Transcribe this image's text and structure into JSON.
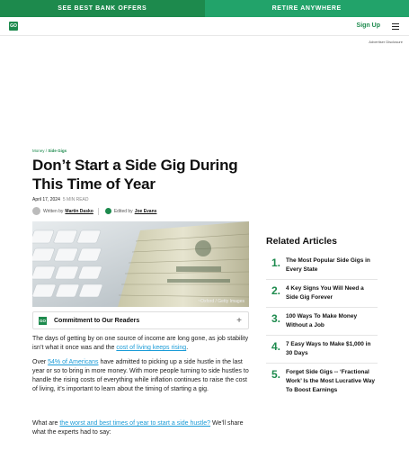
{
  "topbar": {
    "left_label": "SEE BEST BANK OFFERS",
    "right_label": "RETIRE ANYWHERE",
    "colors": {
      "left": "#1d8a4d",
      "right": "#22a36a"
    }
  },
  "header": {
    "logo_text": "GO",
    "signup_label": "Sign Up",
    "menu_icon": "hamburger-menu-icon"
  },
  "ad_disclosure": "Advertiser Disclosure",
  "breadcrumb": {
    "root": "Money",
    "separator": "/",
    "current": "Side Gigs"
  },
  "article": {
    "title": "Don’t Start a Side Gig During This Time of Year",
    "date": "April 17, 2024",
    "read_time": "5 MIN READ",
    "written_by_label": "Written by",
    "author": "Martin Dasko",
    "edited_by_label": "Edited by",
    "editor": "Joe Evans",
    "image_credit": "~Oxford / Getty Images",
    "commitment_label": "Commitment to Our Readers",
    "commitment_logo": "GO",
    "p1_text": "The days of getting by on one source of income are long gone, as job stability isn’t what it once was and the ",
    "p1_link": "cost of living keeps rising",
    "p1_end": ".",
    "p2_start": "Over ",
    "p2_link": "54% of Americans",
    "p2_text": " have admitted to picking up a side hustle in the last year or so to bring in more money. With more people turning to side hustles to handle the rising costs of everything while inflation continues to raise the cost of living, it’s important to learn about the timing of starting a gig.",
    "p3_start": "What are ",
    "p3_link": "the worst and best times of year to start a side hustle?",
    "p3_text": " We’ll share what the experts had to say:"
  },
  "related": {
    "heading": "Related Articles",
    "items": [
      {
        "num": "1.",
        "text": "The Most Popular Side Gigs in Every State"
      },
      {
        "num": "2.",
        "text": "4 Key Signs You Will Need a Side Gig Forever"
      },
      {
        "num": "3.",
        "text": "100 Ways To Make Money Without a Job"
      },
      {
        "num": "4.",
        "text": "7 Easy Ways to Make $1,000 in 30 Days"
      },
      {
        "num": "5.",
        "text": "Forget Side Gigs -- ‘Fractional Work’ Is the Most Lucrative Way To Boost Earnings"
      }
    ]
  }
}
